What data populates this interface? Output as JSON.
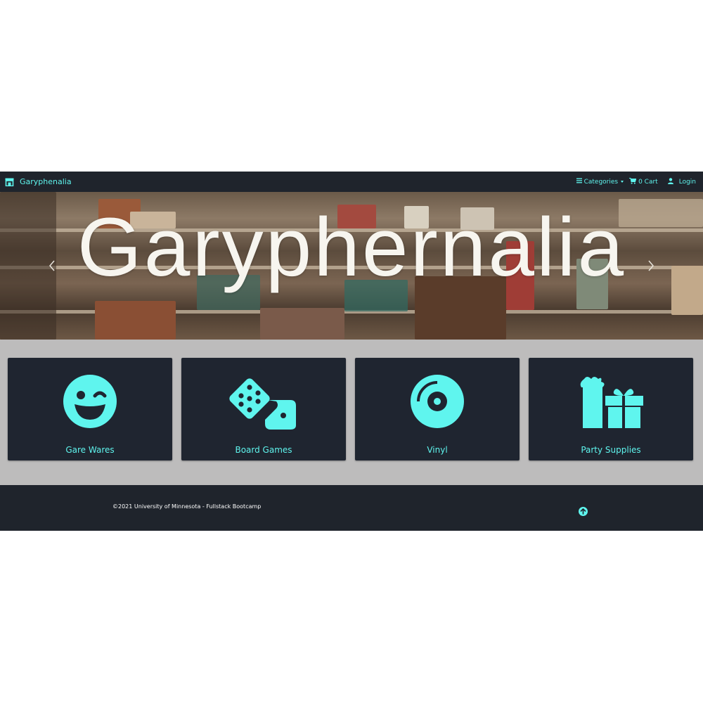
{
  "navbar": {
    "brand": "Garyphenalia",
    "brand_icon": "store-icon",
    "categories_label": "Categories",
    "cart_label": "0 Cart",
    "login_label": "Login",
    "accent_color": "#5ff5ee"
  },
  "hero": {
    "title": "Garyphernalia"
  },
  "categories": [
    {
      "label": "Gare Wares",
      "icon": "grin-wink-icon"
    },
    {
      "label": "Board Games",
      "icon": "dice-icon"
    },
    {
      "label": "Vinyl",
      "icon": "compact-disc-icon"
    },
    {
      "label": "Party Supplies",
      "icon": "gifts-icon"
    }
  ],
  "footer": {
    "copyright": "©2021 University of Minnesota - Fullstack Bootcamp",
    "back_to_top_icon": "arrow-circle-up-icon"
  }
}
